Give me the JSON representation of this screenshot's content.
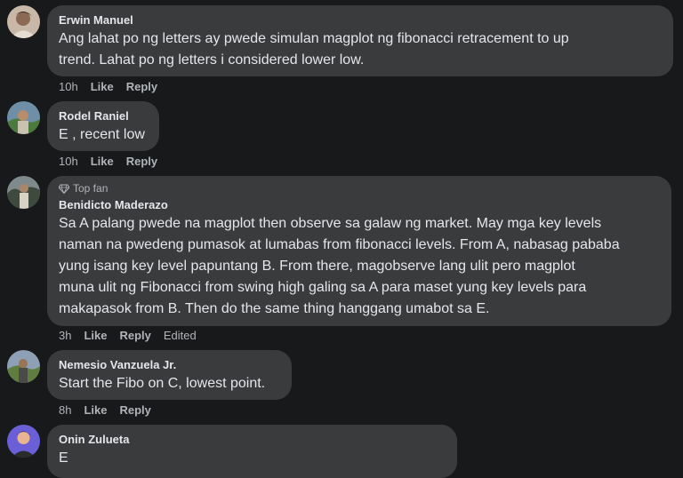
{
  "comments": [
    {
      "author": "Erwin Manuel",
      "lines": [
        "Ang lahat po ng letters ay pwede simulan magplot ng fibonacci retracement to up",
        "trend. Lahat po ng letters i considered lower low."
      ],
      "time": "10h",
      "like": "Like",
      "reply": "Reply"
    },
    {
      "author": "Rodel Raniel",
      "lines": [
        "E , recent low"
      ],
      "time": "10h",
      "like": "Like",
      "reply": "Reply"
    },
    {
      "badge": "Top fan",
      "author": "Benidicto Maderazo",
      "lines": [
        "Sa A palang pwede na magplot then observe sa galaw ng market. May mga key levels",
        "naman na pwedeng pumasok at lumabas from fibonacci levels. From A, nabasag pababa",
        "yung isang key level papuntang B. From there, magobserve lang ulit pero magplot",
        "muna ulit ng Fibonacci from swing high galing sa A para maset yung key levels para",
        "makapasok from B. Then do the same thing hanggang umabot sa E."
      ],
      "time": "3h",
      "like": "Like",
      "reply": "Reply",
      "edited": "Edited"
    },
    {
      "author": "Nemesio Vanzuela Jr.",
      "lines": [
        "Start the Fibo on C, lowest point."
      ],
      "time": "8h",
      "like": "Like",
      "reply": "Reply"
    },
    {
      "author": "Onin Zulueta",
      "lines": [
        "E"
      ]
    }
  ],
  "colors": {
    "background": "#18191a",
    "bubble": "#3a3b3c",
    "primary_text": "#e4e6eb",
    "secondary_text": "#b0b3b8"
  }
}
